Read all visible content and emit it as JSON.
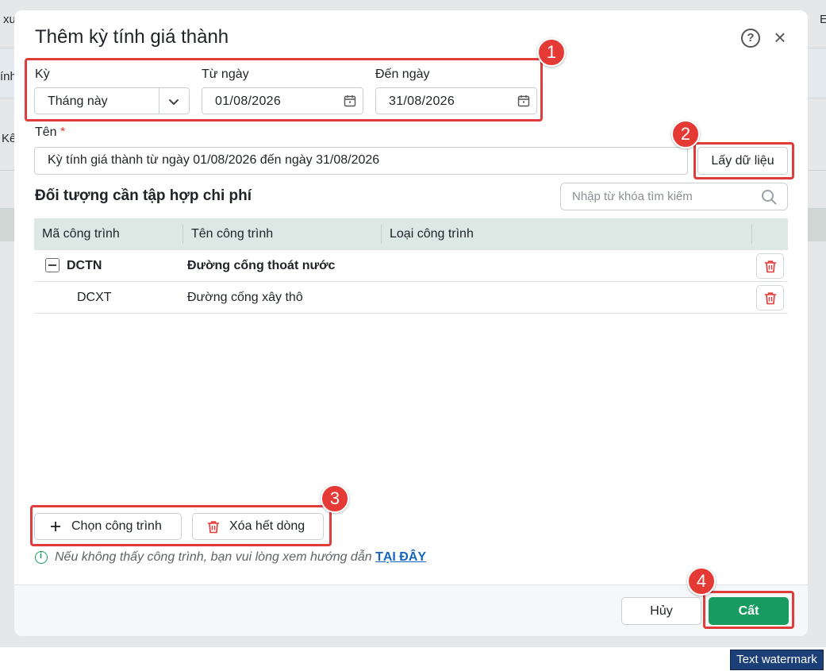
{
  "background": {
    "frag1": "xu",
    "frag2": "ính",
    "frag3": "Kê",
    "frag4": "E"
  },
  "modal": {
    "title": "Thêm kỳ tính giá thành",
    "period": {
      "label": "Kỳ",
      "value": "Tháng này"
    },
    "from_date": {
      "label": "Từ ngày",
      "value": "01/08/2026"
    },
    "to_date": {
      "label": "Đến ngày",
      "value": "31/08/2026"
    },
    "name": {
      "label": "Tên",
      "required_mark": "*",
      "value": "Kỳ tính giá thành từ ngày 01/08/2026 đến ngày 31/08/2026"
    },
    "fetch_button": "Lấy dữ liệu",
    "section_title": "Đối tượng cần tập hợp chi phí",
    "search_placeholder": "Nhập từ khóa tìm kiếm",
    "table": {
      "columns": [
        "Mã công trình",
        "Tên công trình",
        "Loại công trình"
      ],
      "rows": [
        {
          "code": "DCTN",
          "name": "Đường cống thoát nước",
          "type": ""
        },
        {
          "code": "DCXT",
          "name": "Đường cống xây thô",
          "type": ""
        }
      ]
    },
    "add_button": "Chọn công trình",
    "clear_button": "Xóa hết dòng",
    "note_text": "Nếu không thấy công trình, bạn vui lòng xem hướng dẫn ",
    "note_link": "TẠI ĐÂY",
    "cancel_button": "Hủy",
    "save_button": "Cất"
  },
  "annotations": [
    "1",
    "2",
    "3",
    "4"
  ],
  "watermark": "Text watermark",
  "colors": {
    "accent": "#179b60",
    "highlight": "#e03c3c",
    "table_header": "#dbe8e4",
    "link": "#1565c0"
  }
}
